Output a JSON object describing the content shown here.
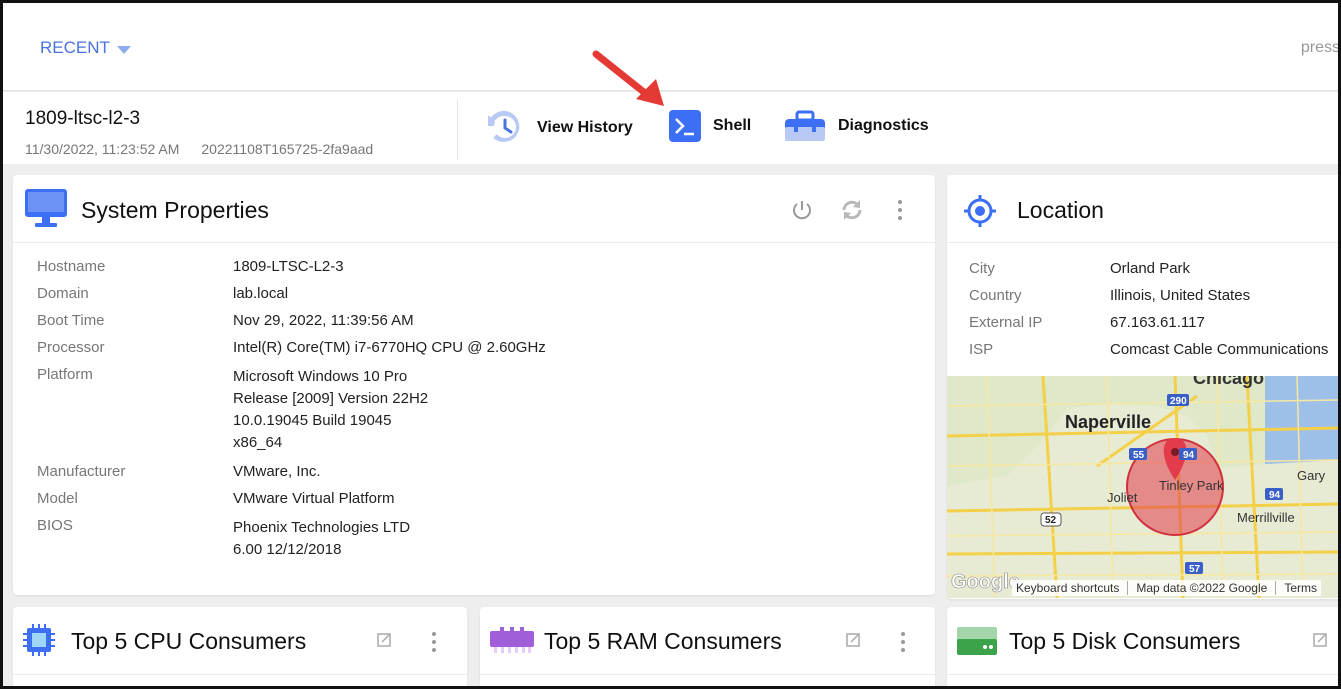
{
  "topbar": {
    "recent_label": "RECENT",
    "press_text": "press"
  },
  "device": {
    "name": "1809-ltsc-l2-3",
    "timestamp": "11/30/2022, 11:23:52 AM",
    "build_id": "20221108T165725-2fa9aad"
  },
  "actions": {
    "view_history": "View History",
    "shell": "Shell",
    "diagnostics": "Diagnostics"
  },
  "system_properties": {
    "title": "System Properties",
    "rows": [
      {
        "key": "Hostname",
        "values": [
          "1809-LTSC-L2-3"
        ]
      },
      {
        "key": "Domain",
        "values": [
          "lab.local"
        ]
      },
      {
        "key": "Boot Time",
        "values": [
          "Nov 29, 2022, 11:39:56 AM"
        ]
      },
      {
        "key": "Processor",
        "values": [
          "Intel(R) Core(TM) i7-6770HQ CPU @ 2.60GHz"
        ]
      },
      {
        "key": "Platform",
        "values": [
          "Microsoft Windows 10 Pro",
          "Release [2009] Version 22H2",
          "10.0.19045 Build 19045",
          "x86_64"
        ]
      },
      {
        "key": "Manufacturer",
        "values": [
          "VMware, Inc."
        ]
      },
      {
        "key": "Model",
        "values": [
          "VMware Virtual Platform"
        ]
      },
      {
        "key": "BIOS",
        "values": [
          "Phoenix Technologies LTD",
          "6.00 12/12/2018"
        ]
      }
    ]
  },
  "location": {
    "title": "Location",
    "rows": [
      {
        "key": "City",
        "value": "Orland Park"
      },
      {
        "key": "Country",
        "value": "Illinois, United States"
      },
      {
        "key": "External IP",
        "value": "67.163.61.117"
      },
      {
        "key": "ISP",
        "value": "Comcast Cable Communications"
      }
    ],
    "map": {
      "labels": {
        "chicago": "Chicago",
        "naperville": "Naperville",
        "tinley_park": "Tinley Park",
        "joliet": "Joliet",
        "gary": "Gary",
        "merrillville": "Merrillville"
      },
      "shields": {
        "i290": "290",
        "i55": "55",
        "i94": "94",
        "i94b": "94",
        "us52": "52",
        "i57": "57"
      },
      "google": "Google",
      "footer": {
        "shortcuts": "Keyboard shortcuts",
        "mapdata": "Map data ©2022 Google",
        "terms": "Terms"
      }
    }
  },
  "cpu_card": {
    "title": "Top 5 CPU Consumers"
  },
  "ram_card": {
    "title": "Top 5 RAM Consumers"
  },
  "disk_card": {
    "title": "Top 5 Disk Consumers"
  },
  "colors": {
    "accent": "#4a72e0",
    "shell_icon": "#3d6ff5",
    "arrow": "#e53935",
    "map_pin": "#e23b4b",
    "ram_icon": "#a05fd8",
    "disk_icon": "#3da34a"
  }
}
